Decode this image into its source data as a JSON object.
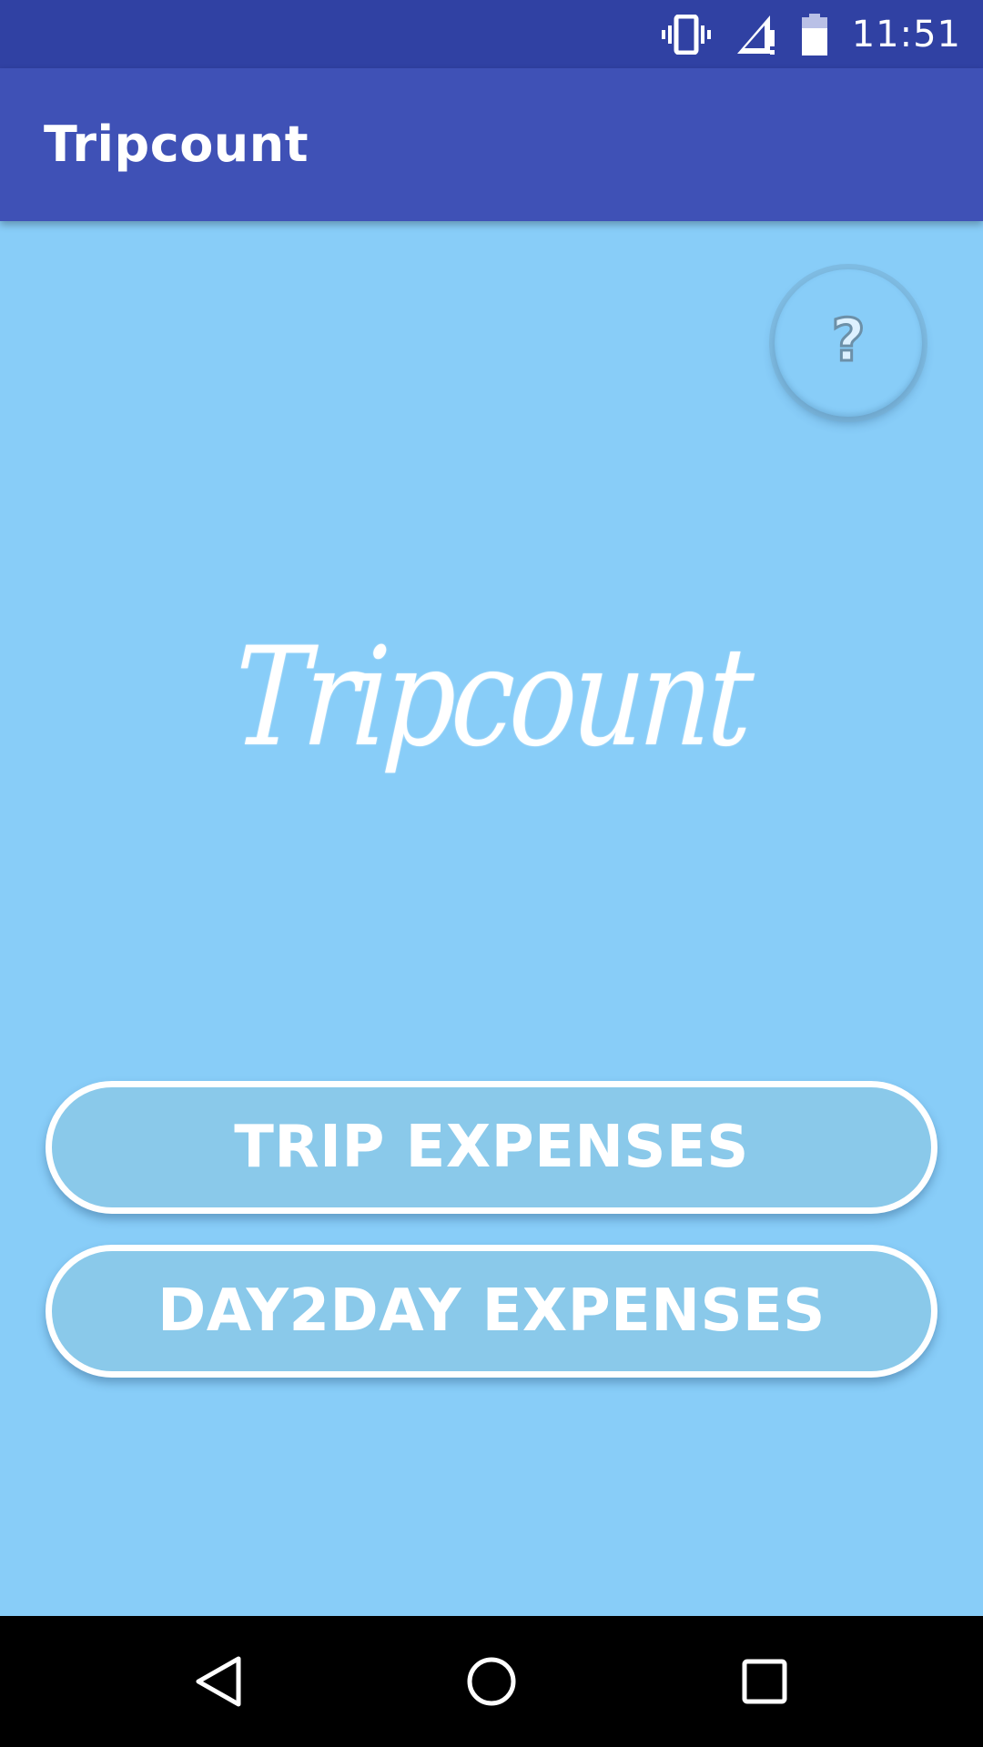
{
  "status_bar": {
    "time": "11:51",
    "icons": [
      "vibrate-icon",
      "signal-icon",
      "battery-icon"
    ],
    "background": "#3041A3"
  },
  "app_bar": {
    "title": "Tripcount",
    "background": "#3F51B6"
  },
  "help_button": {
    "glyph": "?"
  },
  "logo": {
    "text": "Tripcount"
  },
  "buttons": {
    "trip_label": "TRIP EXPENSES",
    "day2day_label": "DAY2DAY EXPENSES"
  },
  "navigation": {
    "icons": [
      "back-icon",
      "home-icon",
      "recent-apps-icon"
    ]
  },
  "colors": {
    "background": "#88CDF8",
    "button_fill": "#8AC9EA",
    "button_border": "#FFFFFF"
  }
}
